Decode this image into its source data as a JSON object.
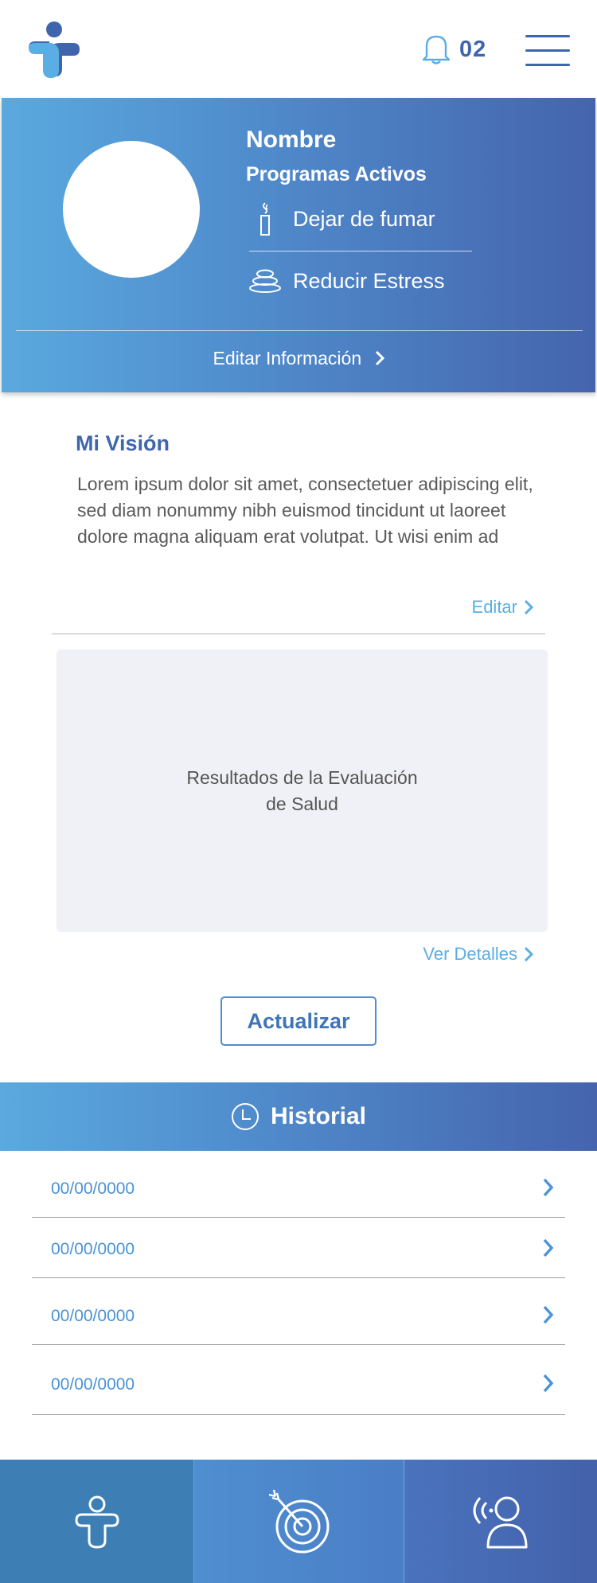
{
  "header": {
    "notification_count": "02"
  },
  "profile": {
    "name": "Nombre",
    "programs_title": "Programas Activos",
    "programs": [
      {
        "label": "Dejar de fumar",
        "icon": "candle-icon"
      },
      {
        "label": "Reducir Estress",
        "icon": "stones-icon"
      }
    ],
    "edit_label": "Editar Información"
  },
  "vision": {
    "title": "Mi Visión",
    "body": "Lorem ipsum dolor sit amet, consectetuer adipiscing elit, sed diam nonummy nibh euismod tincidunt ut laoreet dolore magna aliquam erat volutpat. Ut wisi enim ad",
    "edit_label": "Editar"
  },
  "results": {
    "text": "Resultados de la Evaluación de Salud",
    "details_label": "Ver Detalles"
  },
  "update_button": "Actualizar",
  "history": {
    "title": "Historial",
    "items": [
      {
        "date": "00/00/0000"
      },
      {
        "date": "00/00/0000"
      },
      {
        "date": "00/00/0000"
      },
      {
        "date": "00/00/0000"
      }
    ]
  },
  "bottom_nav": {
    "items": [
      {
        "icon": "health-person-icon"
      },
      {
        "icon": "target-icon"
      },
      {
        "icon": "user-signal-icon"
      }
    ]
  },
  "colors": {
    "primary": "#3f66ad",
    "accent": "#5aaee4",
    "gradient_start": "#5aa9df",
    "gradient_end": "#4564ad"
  }
}
